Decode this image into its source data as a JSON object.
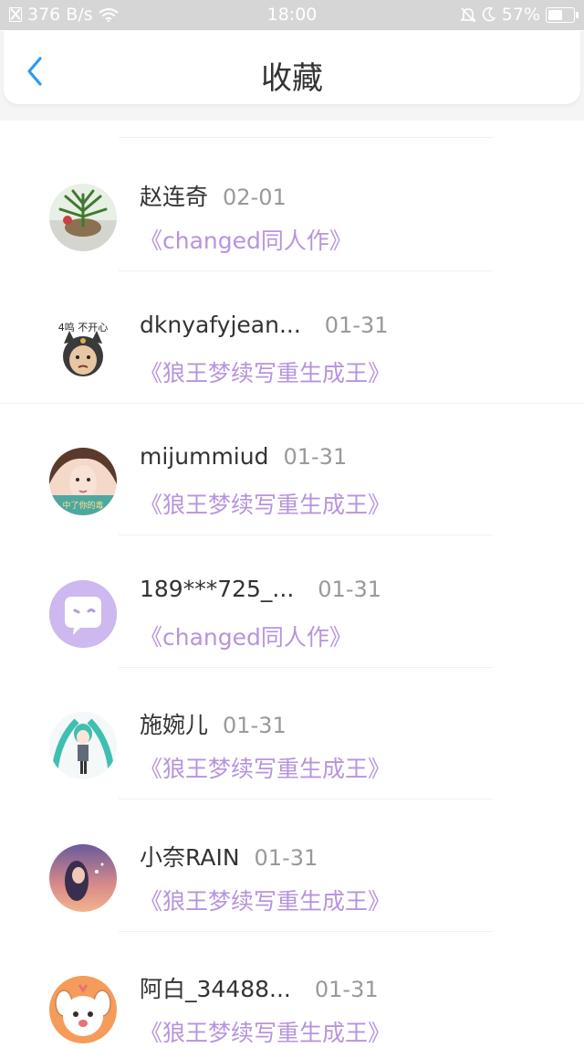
{
  "status_bar": {
    "network_speed": "376 B/s",
    "time": "18:00",
    "battery": "57%",
    "battery_level": 0.57,
    "icons": [
      "no-sim-icon",
      "wifi-icon",
      "mute-bell-icon",
      "moon-icon",
      "battery-icon"
    ]
  },
  "header": {
    "back_icon": "chevron-left-icon",
    "title": "收藏",
    "accent_color": "#2b9af3"
  },
  "favorites": [
    {
      "user": "赵连奇",
      "date": "02-01",
      "book": "《changed同人作》"
    },
    {
      "user": "dknyafyjean...",
      "date": "01-31",
      "book": "《狼王梦续写重生成王》"
    },
    {
      "user": "mijummiud",
      "date": "01-31",
      "book": "《狼王梦续写重生成王》"
    },
    {
      "user": "189***725_...",
      "date": "01-31",
      "book": "《changed同人作》"
    },
    {
      "user": "施婉儿",
      "date": "01-31",
      "book": "《狼王梦续写重生成王》"
    },
    {
      "user": "小奈RAIN",
      "date": "01-31",
      "book": "《狼王梦续写重生成王》"
    },
    {
      "user": "阿白_34488...",
      "date": "01-31",
      "book": "《狼王梦续写重生成王》"
    }
  ],
  "avatar_texts": {
    "cat_caption": "4鸣 不开心",
    "girl_caption": "中了你的毒"
  },
  "colors": {
    "book_title": "#b794dd",
    "default_avatar": "#cdb8f0"
  }
}
